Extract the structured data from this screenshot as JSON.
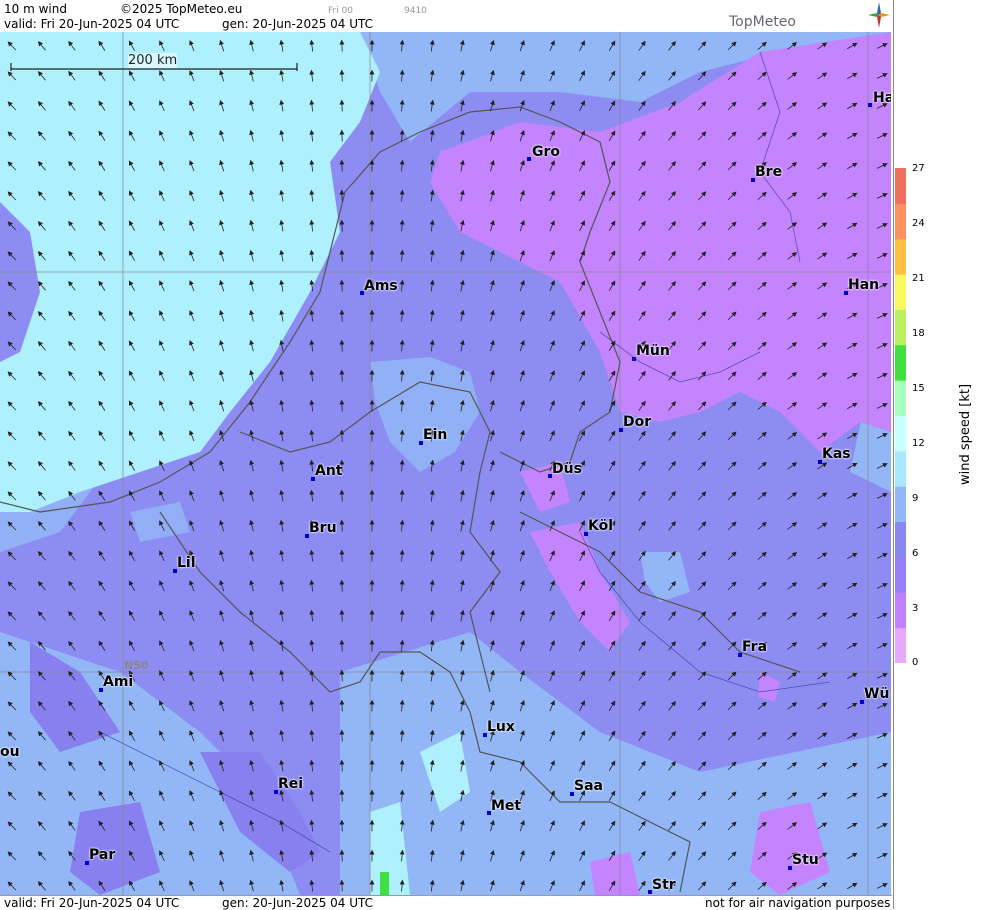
{
  "header": {
    "product": "10 m wind",
    "copyright": "©2025 TopMeteo.eu",
    "run_small": "Fri 00",
    "code_small": "9410",
    "valid": "valid:  Fri  20-Jun-2025  04 UTC",
    "gen": "gen: 20-Jun-2025 04 UTC",
    "logo": "TopMeteo"
  },
  "footer": {
    "valid": "valid:  Fri  20-Jun-2025  04 UTC",
    "gen": "gen: 20-Jun-2025 04 UTC",
    "disclaimer": "not for air navigation purposes"
  },
  "map": {
    "scale_label": "200 km",
    "lat_label": "N50",
    "cities": [
      {
        "name": "Gro"
      },
      {
        "name": "Bre"
      },
      {
        "name": "Ha"
      },
      {
        "name": "Ams"
      },
      {
        "name": "Han"
      },
      {
        "name": "Mün"
      },
      {
        "name": "Dor"
      },
      {
        "name": "Ein"
      },
      {
        "name": "Kas"
      },
      {
        "name": "Ant"
      },
      {
        "name": "Düs"
      },
      {
        "name": "Köl"
      },
      {
        "name": "Bru"
      },
      {
        "name": "Lil"
      },
      {
        "name": "Fra"
      },
      {
        "name": "Ami"
      },
      {
        "name": "Wü"
      },
      {
        "name": "Lux"
      },
      {
        "name": "ou"
      },
      {
        "name": "Rei"
      },
      {
        "name": "Saa"
      },
      {
        "name": "Met"
      },
      {
        "name": "Par"
      },
      {
        "name": "Stu"
      },
      {
        "name": "Str"
      }
    ]
  },
  "legend": {
    "title": "wind  speed  [kt]",
    "ticks": [
      "27",
      "24",
      "21",
      "18",
      "15",
      "12",
      "9",
      "6",
      "3",
      "0"
    ],
    "colors": [
      "#e8a8ff",
      "#c080ff",
      "#9a80f8",
      "#8888f0",
      "#90b8f8",
      "#a8e8ff",
      "#c8ffff",
      "#a8ffc0",
      "#40e040",
      "#b8f060",
      "#f8f860",
      "#ffc040",
      "#ff9060",
      "#f07060"
    ]
  }
}
